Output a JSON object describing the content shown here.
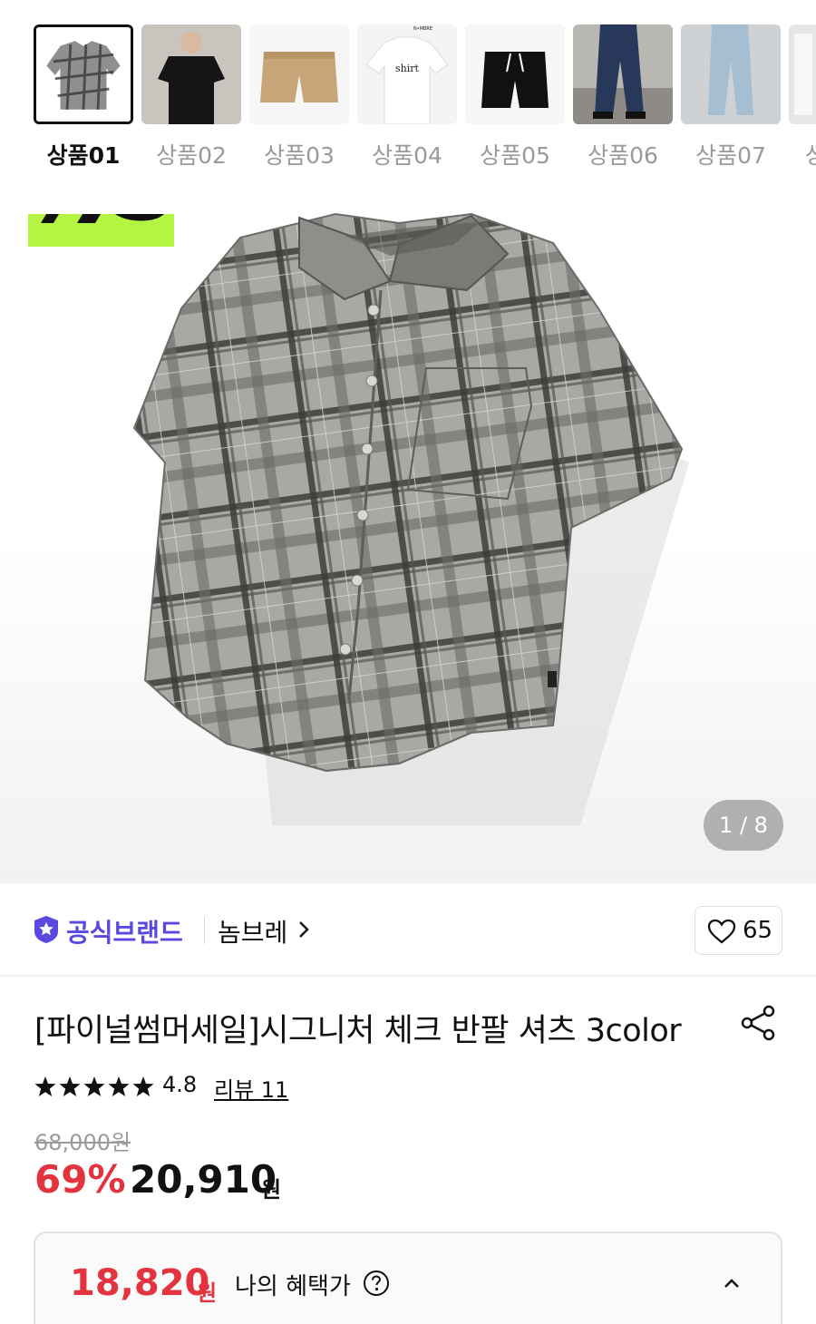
{
  "thumbnails": [
    {
      "label": "상품01",
      "active": true,
      "image": "gray-plaid-shirt"
    },
    {
      "label": "상품02",
      "active": false,
      "image": "model-black-tee"
    },
    {
      "label": "상품03",
      "active": false,
      "image": "beige-cargo-shorts"
    },
    {
      "label": "상품04",
      "active": false,
      "image": "white-shirt-tee"
    },
    {
      "label": "상품05",
      "active": false,
      "image": "black-shorts"
    },
    {
      "label": "상품06",
      "active": false,
      "image": "model-wide-jeans"
    },
    {
      "label": "상품07",
      "active": false,
      "image": "light-wide-jeans"
    },
    {
      "label": "상",
      "active": false,
      "image": "partial-thumb"
    }
  ],
  "thumb_texts": {
    "nombre": "N•MBRE",
    "shirt": "shirt"
  },
  "gallery": {
    "page_indicator": "1 / 8"
  },
  "brand": {
    "official_label": "공식브랜드",
    "name": "놈브레",
    "like_count": "65",
    "official_icon": "star-shield-icon",
    "accent_color": "#5a48e0"
  },
  "product": {
    "title": "[파이널썸머세일]시그니처 체크 반팔 셔츠 3color",
    "rating": "4.8",
    "review_label": "리뷰 11",
    "star_count": 5
  },
  "price": {
    "original": "68,000원",
    "discount_rate": "69%",
    "sale": "20,910",
    "sale_unit": "원",
    "sale_color": "#e2333f"
  },
  "benefit": {
    "price": "18,820",
    "unit": "원",
    "label": "나의 혜택가"
  }
}
